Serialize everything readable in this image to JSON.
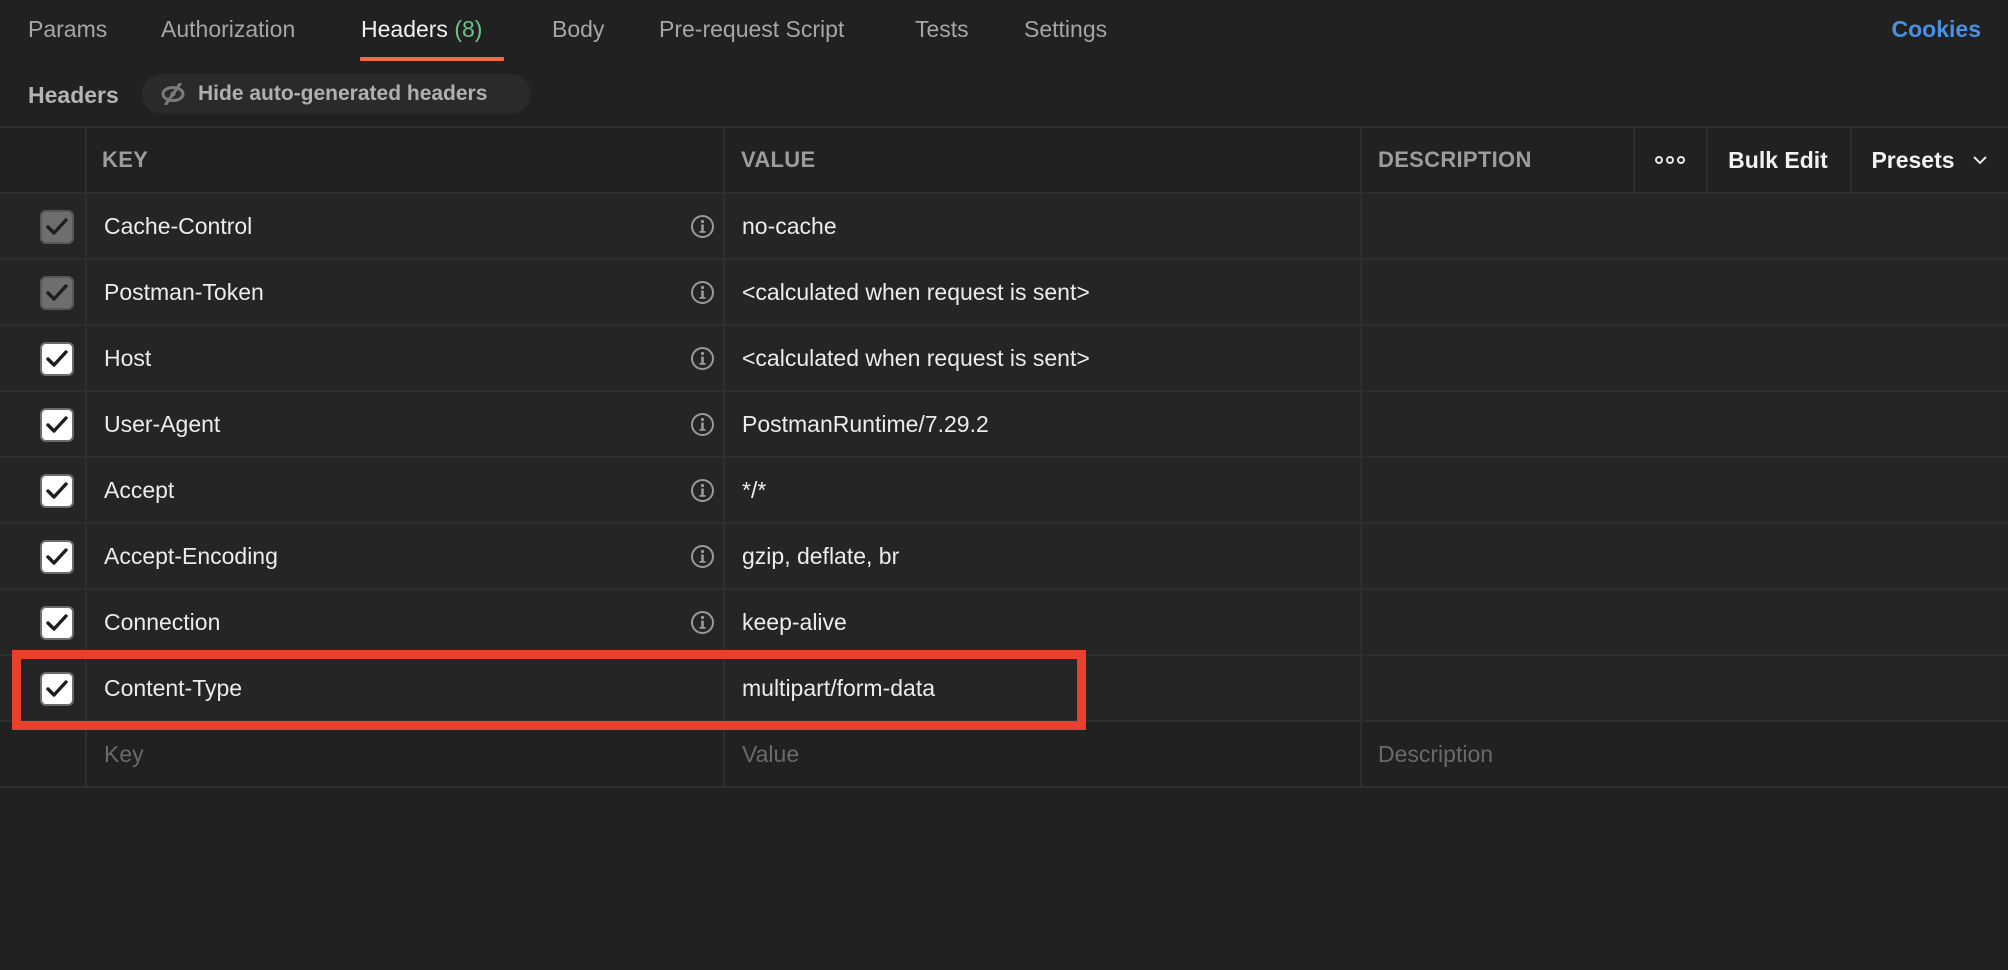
{
  "tabs": [
    {
      "label": "Params",
      "active": false
    },
    {
      "label": "Authorization",
      "active": false
    },
    {
      "label": "Headers",
      "count": "(8)",
      "active": true
    },
    {
      "label": "Body",
      "active": false
    },
    {
      "label": "Pre-request Script",
      "active": false
    },
    {
      "label": "Tests",
      "active": false
    },
    {
      "label": "Settings",
      "active": false
    }
  ],
  "cookies_label": "Cookies",
  "subheader": {
    "title": "Headers",
    "toggle_label": "Hide auto-generated headers",
    "toggle_icon": "eye-slash-icon"
  },
  "table": {
    "columns": {
      "key": "KEY",
      "value": "VALUE",
      "description": "DESCRIPTION"
    },
    "actions": {
      "more": "more-options-icon",
      "bulk_edit": "Bulk Edit",
      "presets": "Presets"
    },
    "rows": [
      {
        "key": "Cache-Control",
        "value": "no-cache",
        "checked": true,
        "auto_generated": true,
        "info": true
      },
      {
        "key": "Postman-Token",
        "value": "<calculated when request is sent>",
        "checked": true,
        "auto_generated": true,
        "info": true
      },
      {
        "key": "Host",
        "value": "<calculated when request is sent>",
        "checked": true,
        "auto_generated": false,
        "info": true
      },
      {
        "key": "User-Agent",
        "value": "PostmanRuntime/7.29.2",
        "checked": true,
        "auto_generated": false,
        "info": true
      },
      {
        "key": "Accept",
        "value": "*/*",
        "checked": true,
        "auto_generated": false,
        "info": true
      },
      {
        "key": "Accept-Encoding",
        "value": "gzip, deflate, br",
        "checked": true,
        "auto_generated": false,
        "info": true
      },
      {
        "key": "Connection",
        "value": "keep-alive",
        "checked": true,
        "auto_generated": false,
        "info": true
      },
      {
        "key": "Content-Type",
        "value": "multipart/form-data",
        "checked": true,
        "auto_generated": false,
        "info": false,
        "highlighted": true
      }
    ],
    "placeholder": {
      "key": "Key",
      "value": "Value",
      "description": "Description"
    }
  },
  "colors": {
    "background": "#212121",
    "row_background": "#252525",
    "active_tab_underline": "#ef6c3f",
    "count_badge": "#6cc38a",
    "cookies_link": "#4a90e2",
    "annotation_box": "#e8402a"
  }
}
